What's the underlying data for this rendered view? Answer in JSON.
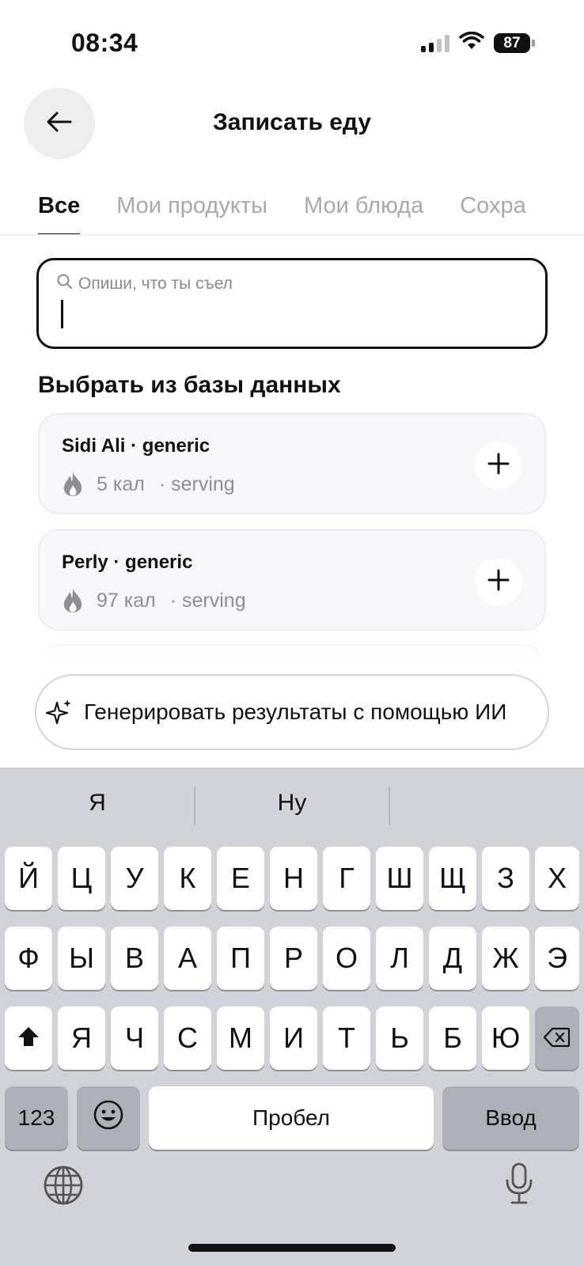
{
  "status_bar": {
    "time": "08:34",
    "battery": "87"
  },
  "header": {
    "title": "Записать еду"
  },
  "tabs": [
    {
      "label": "Все",
      "active": true
    },
    {
      "label": "Мои продукты",
      "active": false
    },
    {
      "label": "Мои блюда",
      "active": false
    },
    {
      "label": "Сохра",
      "active": false
    }
  ],
  "search": {
    "placeholder": "Опиши, что ты съел",
    "value": ""
  },
  "database": {
    "title": "Выбрать из базы данных",
    "items": [
      {
        "name": "Sidi Ali · generic",
        "calories": "5 кал",
        "unit": "· serving"
      },
      {
        "name": "Perly · generic",
        "calories": "97 кал",
        "unit": "· serving"
      }
    ]
  },
  "ai_button": {
    "label": "Генерировать результаты с помощью ИИ"
  },
  "keyboard": {
    "suggestions": [
      "Я",
      "Ну",
      ""
    ],
    "row1": [
      "Й",
      "Ц",
      "У",
      "К",
      "Е",
      "Н",
      "Г",
      "Ш",
      "Щ",
      "З",
      "Х"
    ],
    "row2": [
      "Ф",
      "Ы",
      "В",
      "А",
      "П",
      "Р",
      "О",
      "Л",
      "Д",
      "Ж",
      "Э"
    ],
    "row3": [
      "Я",
      "Ч",
      "С",
      "М",
      "И",
      "Т",
      "Ь",
      "Б",
      "Ю"
    ],
    "numbers_key": "123",
    "space_key": "Пробел",
    "return_key": "Ввод"
  },
  "icons": {
    "back": "arrow-left-icon",
    "search": "search-icon",
    "calories": "flame-icon",
    "add": "plus-icon",
    "ai": "sparkles-icon",
    "shift": "shift-icon",
    "delete": "backspace-icon",
    "emoji": "emoji-icon",
    "globe": "globe-icon",
    "mic": "microphone-icon"
  }
}
